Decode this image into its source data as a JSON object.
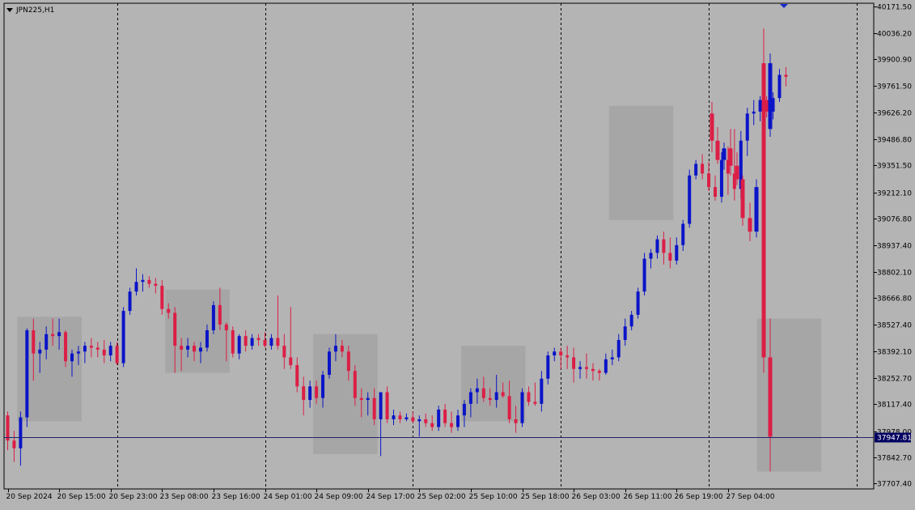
{
  "window": {
    "symbol_title": "JPN225,H1"
  },
  "price_marker": {
    "label": "37947.81",
    "value": 37947.81
  },
  "colors": {
    "background": "#b4b4b4",
    "bull": "#0a14c8",
    "bear": "#dc1e46",
    "box": "#a0a0a0",
    "price_line": "#22226e",
    "frame": "#000000"
  },
  "chart_data": {
    "type": "candlestick",
    "timeframe": "H1",
    "y_axis": {
      "ylim": [
        37680,
        40190
      ],
      "tick_labels": [
        "40171.50",
        "40036.20",
        "39900.90",
        "39761.50",
        "39626.20",
        "39486.80",
        "39351.50",
        "39212.10",
        "39076.80",
        "38937.40",
        "38802.10",
        "38666.80",
        "38527.40",
        "38392.10",
        "38252.70",
        "38117.40",
        "37978.00",
        "37842.70",
        "37707.40"
      ]
    },
    "x_axis": {
      "tick_labels": [
        "20 Sep 2024",
        "20 Sep 15:00",
        "20 Sep 23:00",
        "23 Sep 08:00",
        "23 Sep 16:00",
        "24 Sep 01:00",
        "24 Sep 09:00",
        "24 Sep 17:00",
        "25 Sep 02:00",
        "25 Sep 10:00",
        "25 Sep 18:00",
        "26 Sep 03:00",
        "26 Sep 11:00",
        "26 Sep 19:00",
        "27 Sep 04:00"
      ],
      "tick_bar_index": [
        0,
        8,
        16,
        24,
        32,
        40,
        48,
        56,
        64,
        72,
        80,
        88,
        96,
        104,
        112
      ]
    },
    "period_separator_bar_index": [
      17,
      40,
      63,
      86,
      109,
      132
    ],
    "boxes": [
      {
        "start": 2,
        "end": 11,
        "high": 38570,
        "low": 38030
      },
      {
        "start": 25,
        "end": 34,
        "high": 38710,
        "low": 38280
      },
      {
        "start": 48,
        "end": 57,
        "high": 38480,
        "low": 37860
      },
      {
        "start": 71,
        "end": 80,
        "high": 38420,
        "low": 38030
      },
      {
        "start": 94,
        "end": 103,
        "high": 39660,
        "low": 39070
      },
      {
        "start": 117,
        "end": 126,
        "high": 38560,
        "low": 37770
      }
    ],
    "candles": [
      {
        "o": 38060,
        "h": 38080,
        "l": 37880,
        "c": 37930
      },
      {
        "o": 37930,
        "h": 37980,
        "l": 37820,
        "c": 37890
      },
      {
        "o": 37890,
        "h": 38080,
        "l": 37800,
        "c": 38050
      },
      {
        "o": 38050,
        "h": 38510,
        "l": 38000,
        "c": 38500
      },
      {
        "o": 38500,
        "h": 38560,
        "l": 38240,
        "c": 38380
      },
      {
        "o": 38380,
        "h": 38440,
        "l": 38280,
        "c": 38400
      },
      {
        "o": 38400,
        "h": 38520,
        "l": 38350,
        "c": 38480
      },
      {
        "o": 38480,
        "h": 38560,
        "l": 38420,
        "c": 38470
      },
      {
        "o": 38470,
        "h": 38560,
        "l": 38400,
        "c": 38490
      },
      {
        "o": 38490,
        "h": 38500,
        "l": 38310,
        "c": 38340
      },
      {
        "o": 38340,
        "h": 38400,
        "l": 38260,
        "c": 38380
      },
      {
        "o": 38380,
        "h": 38420,
        "l": 38320,
        "c": 38390
      },
      {
        "o": 38390,
        "h": 38440,
        "l": 38330,
        "c": 38420
      },
      {
        "o": 38420,
        "h": 38460,
        "l": 38360,
        "c": 38410
      },
      {
        "o": 38410,
        "h": 38440,
        "l": 38360,
        "c": 38400
      },
      {
        "o": 38400,
        "h": 38450,
        "l": 38330,
        "c": 38370
      },
      {
        "o": 38370,
        "h": 38440,
        "l": 38340,
        "c": 38420
      },
      {
        "o": 38420,
        "h": 38440,
        "l": 38320,
        "c": 38330
      },
      {
        "o": 38330,
        "h": 38620,
        "l": 38310,
        "c": 38600
      },
      {
        "o": 38600,
        "h": 38720,
        "l": 38580,
        "c": 38700
      },
      {
        "o": 38700,
        "h": 38820,
        "l": 38680,
        "c": 38750
      },
      {
        "o": 38750,
        "h": 38790,
        "l": 38700,
        "c": 38760
      },
      {
        "o": 38760,
        "h": 38780,
        "l": 38720,
        "c": 38740
      },
      {
        "o": 38740,
        "h": 38770,
        "l": 38690,
        "c": 38730
      },
      {
        "o": 38730,
        "h": 38760,
        "l": 38580,
        "c": 38610
      },
      {
        "o": 38610,
        "h": 38640,
        "l": 38560,
        "c": 38590
      },
      {
        "o": 38590,
        "h": 38620,
        "l": 38280,
        "c": 38420
      },
      {
        "o": 38420,
        "h": 38460,
        "l": 38290,
        "c": 38400
      },
      {
        "o": 38400,
        "h": 38460,
        "l": 38360,
        "c": 38420
      },
      {
        "o": 38420,
        "h": 38440,
        "l": 38340,
        "c": 38390
      },
      {
        "o": 38390,
        "h": 38440,
        "l": 38330,
        "c": 38410
      },
      {
        "o": 38410,
        "h": 38530,
        "l": 38390,
        "c": 38500
      },
      {
        "o": 38500,
        "h": 38650,
        "l": 38480,
        "c": 38630
      },
      {
        "o": 38630,
        "h": 38720,
        "l": 38500,
        "c": 38530
      },
      {
        "o": 38530,
        "h": 38540,
        "l": 38340,
        "c": 38500
      },
      {
        "o": 38500,
        "h": 38520,
        "l": 38360,
        "c": 38380
      },
      {
        "o": 38380,
        "h": 38480,
        "l": 38350,
        "c": 38470
      },
      {
        "o": 38470,
        "h": 38500,
        "l": 38390,
        "c": 38420
      },
      {
        "o": 38420,
        "h": 38480,
        "l": 38400,
        "c": 38460
      },
      {
        "o": 38460,
        "h": 38480,
        "l": 38420,
        "c": 38450
      },
      {
        "o": 38450,
        "h": 38490,
        "l": 38410,
        "c": 38420
      },
      {
        "o": 38420,
        "h": 38480,
        "l": 38400,
        "c": 38460
      },
      {
        "o": 38460,
        "h": 38680,
        "l": 38400,
        "c": 38420
      },
      {
        "o": 38420,
        "h": 38480,
        "l": 38300,
        "c": 38360
      },
      {
        "o": 38360,
        "h": 38620,
        "l": 38300,
        "c": 38320
      },
      {
        "o": 38320,
        "h": 38360,
        "l": 38180,
        "c": 38210
      },
      {
        "o": 38210,
        "h": 38260,
        "l": 38060,
        "c": 38140
      },
      {
        "o": 38140,
        "h": 38240,
        "l": 38100,
        "c": 38210
      },
      {
        "o": 38210,
        "h": 38240,
        "l": 38120,
        "c": 38150
      },
      {
        "o": 38150,
        "h": 38290,
        "l": 38100,
        "c": 38270
      },
      {
        "o": 38270,
        "h": 38410,
        "l": 38250,
        "c": 38390
      },
      {
        "o": 38390,
        "h": 38480,
        "l": 38340,
        "c": 38420
      },
      {
        "o": 38420,
        "h": 38450,
        "l": 38360,
        "c": 38390
      },
      {
        "o": 38390,
        "h": 38420,
        "l": 38240,
        "c": 38290
      },
      {
        "o": 38290,
        "h": 38320,
        "l": 38110,
        "c": 38150
      },
      {
        "o": 38150,
        "h": 38200,
        "l": 38050,
        "c": 38140
      },
      {
        "o": 38140,
        "h": 38180,
        "l": 38060,
        "c": 38150
      },
      {
        "o": 38150,
        "h": 38200,
        "l": 38010,
        "c": 38040
      },
      {
        "o": 38040,
        "h": 38180,
        "l": 37850,
        "c": 38180
      },
      {
        "o": 38180,
        "h": 38210,
        "l": 38020,
        "c": 38040
      },
      {
        "o": 38040,
        "h": 38090,
        "l": 38010,
        "c": 38060
      },
      {
        "o": 38060,
        "h": 38080,
        "l": 38020,
        "c": 38040
      },
      {
        "o": 38040,
        "h": 38070,
        "l": 38030,
        "c": 38050
      },
      {
        "o": 38050,
        "h": 38080,
        "l": 38020,
        "c": 38030
      },
      {
        "o": 38030,
        "h": 38060,
        "l": 37950,
        "c": 38040
      },
      {
        "o": 38040,
        "h": 38070,
        "l": 38000,
        "c": 38020
      },
      {
        "o": 38020,
        "h": 38060,
        "l": 37980,
        "c": 38000
      },
      {
        "o": 38000,
        "h": 38110,
        "l": 37980,
        "c": 38090
      },
      {
        "o": 38090,
        "h": 38120,
        "l": 38000,
        "c": 38020
      },
      {
        "o": 38020,
        "h": 38080,
        "l": 37970,
        "c": 38000
      },
      {
        "o": 38000,
        "h": 38090,
        "l": 37980,
        "c": 38060
      },
      {
        "o": 38060,
        "h": 38140,
        "l": 38000,
        "c": 38120
      },
      {
        "o": 38120,
        "h": 38200,
        "l": 38050,
        "c": 38180
      },
      {
        "o": 38180,
        "h": 38250,
        "l": 38120,
        "c": 38200
      },
      {
        "o": 38200,
        "h": 38260,
        "l": 38130,
        "c": 38150
      },
      {
        "o": 38150,
        "h": 38200,
        "l": 38110,
        "c": 38140
      },
      {
        "o": 38140,
        "h": 38270,
        "l": 38100,
        "c": 38180
      },
      {
        "o": 38180,
        "h": 38230,
        "l": 38150,
        "c": 38160
      },
      {
        "o": 38160,
        "h": 38240,
        "l": 38020,
        "c": 38040
      },
      {
        "o": 38040,
        "h": 38110,
        "l": 37970,
        "c": 38020
      },
      {
        "o": 38020,
        "h": 38200,
        "l": 38000,
        "c": 38180
      },
      {
        "o": 38180,
        "h": 38210,
        "l": 38110,
        "c": 38130
      },
      {
        "o": 38130,
        "h": 38230,
        "l": 38110,
        "c": 38120
      },
      {
        "o": 38120,
        "h": 38290,
        "l": 38080,
        "c": 38250
      },
      {
        "o": 38250,
        "h": 38390,
        "l": 38220,
        "c": 38370
      },
      {
        "o": 38370,
        "h": 38410,
        "l": 38340,
        "c": 38390
      },
      {
        "o": 38390,
        "h": 38410,
        "l": 38300,
        "c": 38370
      },
      {
        "o": 38370,
        "h": 38420,
        "l": 38300,
        "c": 38360
      },
      {
        "o": 38360,
        "h": 38410,
        "l": 38230,
        "c": 38300
      },
      {
        "o": 38300,
        "h": 38340,
        "l": 38250,
        "c": 38310
      },
      {
        "o": 38310,
        "h": 38380,
        "l": 38250,
        "c": 38300
      },
      {
        "o": 38300,
        "h": 38330,
        "l": 38240,
        "c": 38290
      },
      {
        "o": 38290,
        "h": 38300,
        "l": 38240,
        "c": 38280
      },
      {
        "o": 38280,
        "h": 38380,
        "l": 38270,
        "c": 38350
      },
      {
        "o": 38350,
        "h": 38400,
        "l": 38320,
        "c": 38360
      },
      {
        "o": 38360,
        "h": 38480,
        "l": 38340,
        "c": 38450
      },
      {
        "o": 38450,
        "h": 38560,
        "l": 38420,
        "c": 38520
      },
      {
        "o": 38520,
        "h": 38600,
        "l": 38500,
        "c": 38580
      },
      {
        "o": 38580,
        "h": 38720,
        "l": 38560,
        "c": 38700
      },
      {
        "o": 38700,
        "h": 38900,
        "l": 38680,
        "c": 38870
      },
      {
        "o": 38870,
        "h": 38920,
        "l": 38820,
        "c": 38900
      },
      {
        "o": 38900,
        "h": 38990,
        "l": 38870,
        "c": 38970
      },
      {
        "o": 38970,
        "h": 39010,
        "l": 38840,
        "c": 38900
      },
      {
        "o": 38900,
        "h": 38980,
        "l": 38820,
        "c": 38860
      },
      {
        "o": 38860,
        "h": 38980,
        "l": 38840,
        "c": 38940
      },
      {
        "o": 38940,
        "h": 39070,
        "l": 38910,
        "c": 39050
      },
      {
        "o": 39050,
        "h": 39330,
        "l": 39030,
        "c": 39300
      },
      {
        "o": 39300,
        "h": 39380,
        "l": 39280,
        "c": 39360
      },
      {
        "o": 39360,
        "h": 39410,
        "l": 39280,
        "c": 39310
      },
      {
        "o": 39310,
        "h": 39370,
        "l": 39220,
        "c": 39240
      },
      {
        "o": 39240,
        "h": 39300,
        "l": 39170,
        "c": 39190
      },
      {
        "o": 39190,
        "h": 39420,
        "l": 39160,
        "c": 39380
      },
      {
        "o": 39380,
        "h": 39450,
        "l": 39200,
        "c": 39310
      },
      {
        "o": 39310,
        "h": 39540,
        "l": 39170,
        "c": 39230
      },
      {
        "o": 39230,
        "h": 39530,
        "l": 39180,
        "c": 39480
      },
      {
        "o": 39480,
        "h": 39650,
        "l": 39400,
        "c": 39620
      },
      {
        "o": 39620,
        "h": 39690,
        "l": 39560,
        "c": 39630
      },
      {
        "o": 39630,
        "h": 39710,
        "l": 39580,
        "c": 39690
      },
      {
        "o": 39690,
        "h": 39710,
        "l": 39600,
        "c": 39630
      },
      {
        "o": 39630,
        "h": 39730,
        "l": 39590,
        "c": 39700
      },
      {
        "o": 39700,
        "h": 39850,
        "l": 39680,
        "c": 39820
      },
      {
        "o": 39820,
        "h": 39860,
        "l": 39760,
        "c": 39810
      }
    ],
    "tail_candles": [
      {
        "o": 39620,
        "h": 39680,
        "l": 39420,
        "c": 39480
      },
      {
        "o": 39480,
        "h": 39550,
        "l": 39360,
        "c": 39380
      },
      {
        "o": 39380,
        "h": 39470,
        "l": 39330,
        "c": 39440
      },
      {
        "o": 39440,
        "h": 39540,
        "l": 39300,
        "c": 39350
      },
      {
        "o": 39350,
        "h": 39420,
        "l": 39250,
        "c": 39280
      },
      {
        "o": 39280,
        "h": 39300,
        "l": 39040,
        "c": 39080
      },
      {
        "o": 39080,
        "h": 39160,
        "l": 38960,
        "c": 39010
      },
      {
        "o": 39010,
        "h": 39280,
        "l": 38980,
        "c": 39240
      },
      {
        "o": 39240,
        "h": 39580,
        "l": 39220,
        "c": 39540
      },
      {
        "o": 39540,
        "h": 39930,
        "l": 39500,
        "c": 39880
      },
      {
        "o": 39880,
        "h": 40060,
        "l": 38280,
        "c": 38360
      },
      {
        "o": 38360,
        "h": 38560,
        "l": 37770,
        "c": 37950
      }
    ]
  }
}
